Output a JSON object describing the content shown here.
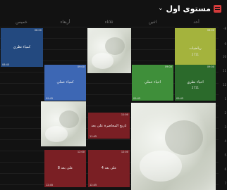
{
  "header": {
    "title": "مستوى اول",
    "chevron": "⌄",
    "icon": "calendar-icon"
  },
  "days": [
    "أحد",
    "اثنين",
    "ثلاثاء",
    "أربعاء",
    "خميس"
  ],
  "times": [
    "-8",
    "9",
    "10",
    "11",
    "12",
    "1",
    "2",
    "3",
    "4",
    "5",
    "6",
    "7"
  ],
  "colors": {
    "background": "#121212",
    "olive": "#a4b33d",
    "dark_green": "#2b6a2b",
    "green": "#3f8f3a",
    "blue": "#3d67b4",
    "dark_blue": "#23497f",
    "red": "#7a1f24",
    "title_icon": "#d43b3b"
  },
  "cards": [
    {
      "id": "khamis",
      "title": "كمياء نظري",
      "sub": "",
      "start": "08:00",
      "end": "08:45"
    },
    {
      "id": "riyadiyat",
      "title": "رياضيات",
      "sub": "2711",
      "start": "08:00",
      "end": "08:45"
    },
    {
      "id": "kimya-amali",
      "title": "كمياء عملي",
      "sub": "",
      "start": "09:00",
      "end": "09:45"
    },
    {
      "id": "ahyaa-amali",
      "title": "احياء عملي",
      "sub": "",
      "start": "09:00",
      "end": "09:45"
    },
    {
      "id": "ahyaa-nathari",
      "title": "احياء نظري",
      "sub": "2711",
      "start": "09:00",
      "end": "09:45"
    },
    {
      "id": "tarikh",
      "title": "تاريخ المحاضرة على بعد",
      "sub": "",
      "start": "11:00",
      "end": "11:45"
    },
    {
      "id": "ala-bud-1",
      "title": "8 على بعد",
      "sub": "",
      "start": "12:00",
      "end": "12:45"
    },
    {
      "id": "ala-bud-2",
      "title": "4 على بعد",
      "sub": "",
      "start": "12:00",
      "end": "12:45"
    }
  ]
}
